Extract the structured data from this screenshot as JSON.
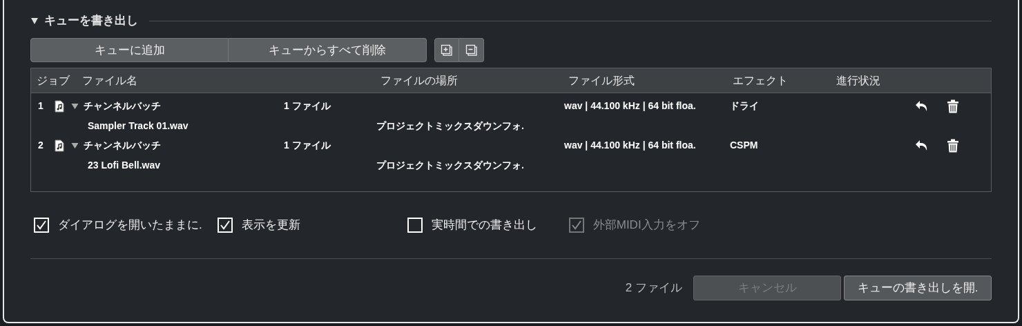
{
  "section": {
    "title": "キューを書き出し",
    "expanded": true
  },
  "queue_buttons": [
    "キューに追加",
    "キューからすべて削除"
  ],
  "table": {
    "columns": [
      "ジョブ",
      "ファイル名",
      "ファイルの場所",
      "ファイル形式",
      "エフェクト",
      "進行状況"
    ],
    "rows": [
      {
        "job": "1",
        "name": "チャンネルバッチ",
        "count": "1 ファイル",
        "format": "wav | 44.100 kHz | 64 bit floa.",
        "effect": "ドライ",
        "expanded": true,
        "children": [
          {
            "name": "Sampler Track 01.wav",
            "location": "プロジェクトミックスダウンフォ."
          }
        ]
      },
      {
        "job": "2",
        "name": "チャンネルバッチ",
        "count": "1 ファイル",
        "format": "wav | 44.100 kHz | 64 bit floa.",
        "effect": "CSPM",
        "expanded": true,
        "children": [
          {
            "name": "23 Lofi Bell.wav",
            "location": "プロジェクトミックスダウンフォ."
          }
        ]
      }
    ]
  },
  "options": [
    {
      "label": "ダイアログを開いたままに.",
      "checked": true,
      "disabled": false
    },
    {
      "label": "表示を更新",
      "checked": true,
      "disabled": false
    },
    {
      "label": "実時間での書き出し",
      "checked": false,
      "disabled": false
    },
    {
      "label": "外部MIDI入力をオフ",
      "checked": true,
      "disabled": true
    }
  ],
  "footer": {
    "count": "2 ファイル",
    "buttons": [
      {
        "label": "キャンセル",
        "disabled": true
      },
      {
        "label": "キューの書き出しを開.",
        "disabled": false
      }
    ]
  }
}
